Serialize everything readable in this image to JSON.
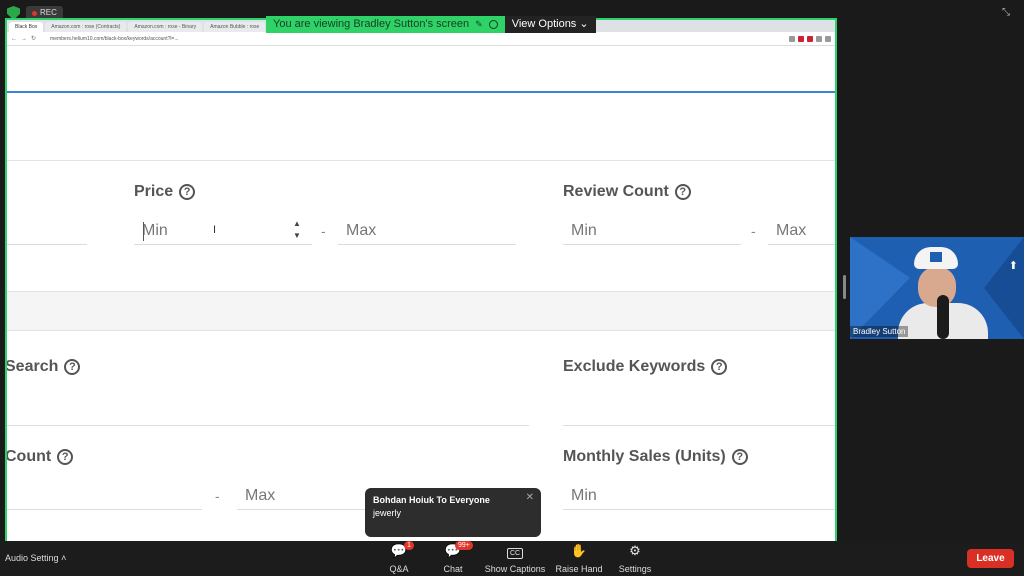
{
  "overlay": {
    "rec_label": "REC"
  },
  "banner": {
    "message": "You are viewing Bradley Sutton's screen",
    "view_options": "View Options"
  },
  "browser": {
    "tabs": [
      "Black Box",
      "Amazon.com : rose (Contracts)",
      "Amazon.com : rose - Binary",
      "Amazon Bubble : rose"
    ],
    "url": "members.helium10.com/black-box/keywords/account?l=..."
  },
  "form": {
    "price": {
      "label": "Price",
      "min_placeholder": "Min",
      "max_placeholder": "Max"
    },
    "review_count": {
      "label": "Review Count",
      "min_placeholder": "Min",
      "max_placeholder": "Max"
    },
    "search": {
      "label": "Search"
    },
    "exclude_keywords": {
      "label": "Exclude Keywords"
    },
    "count": {
      "label": "Count",
      "max_placeholder": "Max"
    },
    "monthly_sales": {
      "label": "Monthly Sales (Units)",
      "min_placeholder": "Min"
    },
    "dash": "-",
    "help_glyph": "?"
  },
  "toast": {
    "from": "Bohdan Hoiuk To Everyone",
    "message": "jewerly"
  },
  "video": {
    "name": "Bradley Sutton"
  },
  "toolbar": {
    "audio_setting": "Audio Setting",
    "qa": {
      "label": "Q&A",
      "badge": "1"
    },
    "chat": {
      "label": "Chat",
      "badge": "99+"
    },
    "captions": {
      "label": "Show Captions",
      "icon_text": "CC"
    },
    "raise_hand": {
      "label": "Raise Hand"
    },
    "settings": {
      "label": "Settings"
    },
    "leave": "Leave"
  }
}
